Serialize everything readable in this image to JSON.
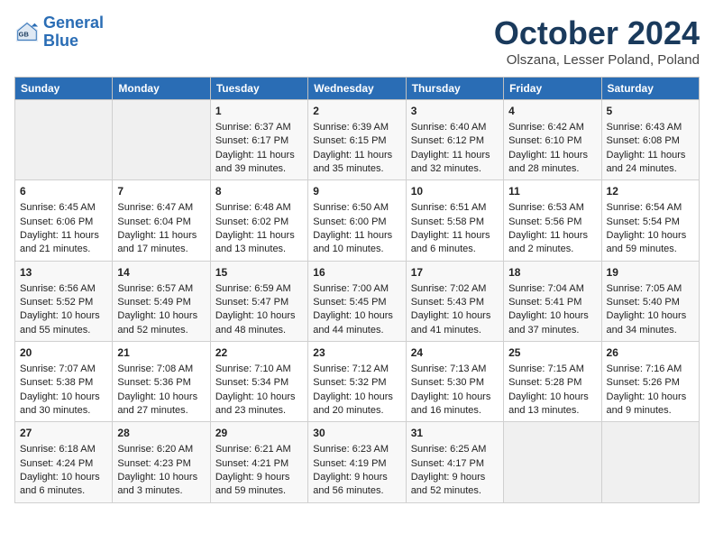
{
  "header": {
    "logo_line1": "General",
    "logo_line2": "Blue",
    "month_title": "October 2024",
    "location": "Olszana, Lesser Poland, Poland"
  },
  "days_of_week": [
    "Sunday",
    "Monday",
    "Tuesday",
    "Wednesday",
    "Thursday",
    "Friday",
    "Saturday"
  ],
  "weeks": [
    [
      {
        "day": "",
        "sunrise": "",
        "sunset": "",
        "daylight": ""
      },
      {
        "day": "",
        "sunrise": "",
        "sunset": "",
        "daylight": ""
      },
      {
        "day": "1",
        "sunrise": "Sunrise: 6:37 AM",
        "sunset": "Sunset: 6:17 PM",
        "daylight": "Daylight: 11 hours and 39 minutes."
      },
      {
        "day": "2",
        "sunrise": "Sunrise: 6:39 AM",
        "sunset": "Sunset: 6:15 PM",
        "daylight": "Daylight: 11 hours and 35 minutes."
      },
      {
        "day": "3",
        "sunrise": "Sunrise: 6:40 AM",
        "sunset": "Sunset: 6:12 PM",
        "daylight": "Daylight: 11 hours and 32 minutes."
      },
      {
        "day": "4",
        "sunrise": "Sunrise: 6:42 AM",
        "sunset": "Sunset: 6:10 PM",
        "daylight": "Daylight: 11 hours and 28 minutes."
      },
      {
        "day": "5",
        "sunrise": "Sunrise: 6:43 AM",
        "sunset": "Sunset: 6:08 PM",
        "daylight": "Daylight: 11 hours and 24 minutes."
      }
    ],
    [
      {
        "day": "6",
        "sunrise": "Sunrise: 6:45 AM",
        "sunset": "Sunset: 6:06 PM",
        "daylight": "Daylight: 11 hours and 21 minutes."
      },
      {
        "day": "7",
        "sunrise": "Sunrise: 6:47 AM",
        "sunset": "Sunset: 6:04 PM",
        "daylight": "Daylight: 11 hours and 17 minutes."
      },
      {
        "day": "8",
        "sunrise": "Sunrise: 6:48 AM",
        "sunset": "Sunset: 6:02 PM",
        "daylight": "Daylight: 11 hours and 13 minutes."
      },
      {
        "day": "9",
        "sunrise": "Sunrise: 6:50 AM",
        "sunset": "Sunset: 6:00 PM",
        "daylight": "Daylight: 11 hours and 10 minutes."
      },
      {
        "day": "10",
        "sunrise": "Sunrise: 6:51 AM",
        "sunset": "Sunset: 5:58 PM",
        "daylight": "Daylight: 11 hours and 6 minutes."
      },
      {
        "day": "11",
        "sunrise": "Sunrise: 6:53 AM",
        "sunset": "Sunset: 5:56 PM",
        "daylight": "Daylight: 11 hours and 2 minutes."
      },
      {
        "day": "12",
        "sunrise": "Sunrise: 6:54 AM",
        "sunset": "Sunset: 5:54 PM",
        "daylight": "Daylight: 10 hours and 59 minutes."
      }
    ],
    [
      {
        "day": "13",
        "sunrise": "Sunrise: 6:56 AM",
        "sunset": "Sunset: 5:52 PM",
        "daylight": "Daylight: 10 hours and 55 minutes."
      },
      {
        "day": "14",
        "sunrise": "Sunrise: 6:57 AM",
        "sunset": "Sunset: 5:49 PM",
        "daylight": "Daylight: 10 hours and 52 minutes."
      },
      {
        "day": "15",
        "sunrise": "Sunrise: 6:59 AM",
        "sunset": "Sunset: 5:47 PM",
        "daylight": "Daylight: 10 hours and 48 minutes."
      },
      {
        "day": "16",
        "sunrise": "Sunrise: 7:00 AM",
        "sunset": "Sunset: 5:45 PM",
        "daylight": "Daylight: 10 hours and 44 minutes."
      },
      {
        "day": "17",
        "sunrise": "Sunrise: 7:02 AM",
        "sunset": "Sunset: 5:43 PM",
        "daylight": "Daylight: 10 hours and 41 minutes."
      },
      {
        "day": "18",
        "sunrise": "Sunrise: 7:04 AM",
        "sunset": "Sunset: 5:41 PM",
        "daylight": "Daylight: 10 hours and 37 minutes."
      },
      {
        "day": "19",
        "sunrise": "Sunrise: 7:05 AM",
        "sunset": "Sunset: 5:40 PM",
        "daylight": "Daylight: 10 hours and 34 minutes."
      }
    ],
    [
      {
        "day": "20",
        "sunrise": "Sunrise: 7:07 AM",
        "sunset": "Sunset: 5:38 PM",
        "daylight": "Daylight: 10 hours and 30 minutes."
      },
      {
        "day": "21",
        "sunrise": "Sunrise: 7:08 AM",
        "sunset": "Sunset: 5:36 PM",
        "daylight": "Daylight: 10 hours and 27 minutes."
      },
      {
        "day": "22",
        "sunrise": "Sunrise: 7:10 AM",
        "sunset": "Sunset: 5:34 PM",
        "daylight": "Daylight: 10 hours and 23 minutes."
      },
      {
        "day": "23",
        "sunrise": "Sunrise: 7:12 AM",
        "sunset": "Sunset: 5:32 PM",
        "daylight": "Daylight: 10 hours and 20 minutes."
      },
      {
        "day": "24",
        "sunrise": "Sunrise: 7:13 AM",
        "sunset": "Sunset: 5:30 PM",
        "daylight": "Daylight: 10 hours and 16 minutes."
      },
      {
        "day": "25",
        "sunrise": "Sunrise: 7:15 AM",
        "sunset": "Sunset: 5:28 PM",
        "daylight": "Daylight: 10 hours and 13 minutes."
      },
      {
        "day": "26",
        "sunrise": "Sunrise: 7:16 AM",
        "sunset": "Sunset: 5:26 PM",
        "daylight": "Daylight: 10 hours and 9 minutes."
      }
    ],
    [
      {
        "day": "27",
        "sunrise": "Sunrise: 6:18 AM",
        "sunset": "Sunset: 4:24 PM",
        "daylight": "Daylight: 10 hours and 6 minutes."
      },
      {
        "day": "28",
        "sunrise": "Sunrise: 6:20 AM",
        "sunset": "Sunset: 4:23 PM",
        "daylight": "Daylight: 10 hours and 3 minutes."
      },
      {
        "day": "29",
        "sunrise": "Sunrise: 6:21 AM",
        "sunset": "Sunset: 4:21 PM",
        "daylight": "Daylight: 9 hours and 59 minutes."
      },
      {
        "day": "30",
        "sunrise": "Sunrise: 6:23 AM",
        "sunset": "Sunset: 4:19 PM",
        "daylight": "Daylight: 9 hours and 56 minutes."
      },
      {
        "day": "31",
        "sunrise": "Sunrise: 6:25 AM",
        "sunset": "Sunset: 4:17 PM",
        "daylight": "Daylight: 9 hours and 52 minutes."
      },
      {
        "day": "",
        "sunrise": "",
        "sunset": "",
        "daylight": ""
      },
      {
        "day": "",
        "sunrise": "",
        "sunset": "",
        "daylight": ""
      }
    ]
  ]
}
